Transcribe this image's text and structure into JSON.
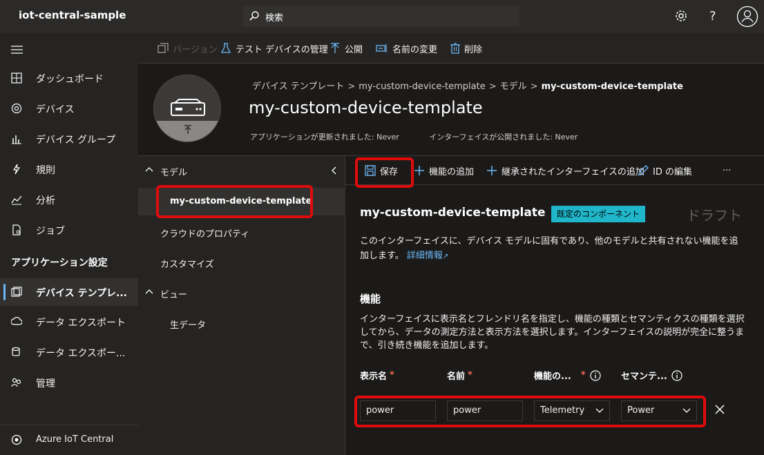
{
  "app": {
    "title": "iot-central-sample"
  },
  "search": {
    "placeholder": "検索"
  },
  "topbar": {
    "icons": [
      "settings-icon",
      "help-icon",
      "account-icon"
    ],
    "help_label": "?"
  },
  "nav": {
    "items": [
      {
        "label": "ダッシュボード",
        "icon": "dashboard-icon"
      },
      {
        "label": "デバイス",
        "icon": "devices-icon"
      },
      {
        "label": "デバイス グループ",
        "icon": "device-groups-icon"
      },
      {
        "label": "規則",
        "icon": "rules-icon"
      },
      {
        "label": "分析",
        "icon": "analytics-icon"
      },
      {
        "label": "ジョブ",
        "icon": "jobs-icon"
      }
    ],
    "section": "アプリケーション設定",
    "settings_items": [
      {
        "label": "デバイス テンプレ...",
        "icon": "device-templates-icon",
        "active": true
      },
      {
        "label": "データ エクスポート",
        "icon": "data-export-icon"
      },
      {
        "label": "データ エクスポー...",
        "icon": "data-export-legacy-icon"
      },
      {
        "label": "管理",
        "icon": "admin-icon"
      }
    ],
    "footer": "Azure IoT Central"
  },
  "commandbar": {
    "version": "バージョン",
    "test_devices": "テスト デバイスの管理",
    "publish": "公開",
    "rename": "名前の変更",
    "delete": "削除"
  },
  "header": {
    "breadcrumb": [
      "デバイス テンプレート",
      "my-custom-device-template",
      "モデル",
      "my-custom-device-template"
    ],
    "title": "my-custom-device-template",
    "app_updated": "アプリケーションが更新されました: Never",
    "iface_published": "インターフェイスが公開されました: Never"
  },
  "tree": {
    "model": "モデル",
    "model_item": "my-custom-device-template",
    "cloud_props": "クラウドのプロパティ",
    "customize": "カスタマイズ",
    "views": "ビュー",
    "raw_data": "生データ"
  },
  "subcommands": {
    "save": "保存",
    "add_capability": "機能の追加",
    "add_inherited": "継承されたインターフェイスの追加",
    "edit_id": "ID の編集",
    "more": "···"
  },
  "interface": {
    "title": "my-custom-device-template",
    "badge": "既定のコンポーネント",
    "status": "ドラフト",
    "description": "このインターフェイスに、デバイス モデルに固有であり、他のモデルと共有されない機能を追加します。",
    "learn_more": "詳細情報"
  },
  "capabilities": {
    "heading": "機能",
    "description": "インターフェイスに表示名とフレンドリ名を指定し、機能の種類とセマンティクスの種類を選択してから、データの測定方法と表示方法を選択します。インターフェイスの説明が完全に整うまで、引き続き機能を追加します。",
    "columns": {
      "display_name": "表示名",
      "name": "名前",
      "capability_type": "機能の...",
      "semantic_type": "セマンテ..."
    },
    "required_mark": "*",
    "row": {
      "display_name": "power",
      "name": "power",
      "capability_type": "Telemetry",
      "semantic_type": "Power"
    }
  }
}
